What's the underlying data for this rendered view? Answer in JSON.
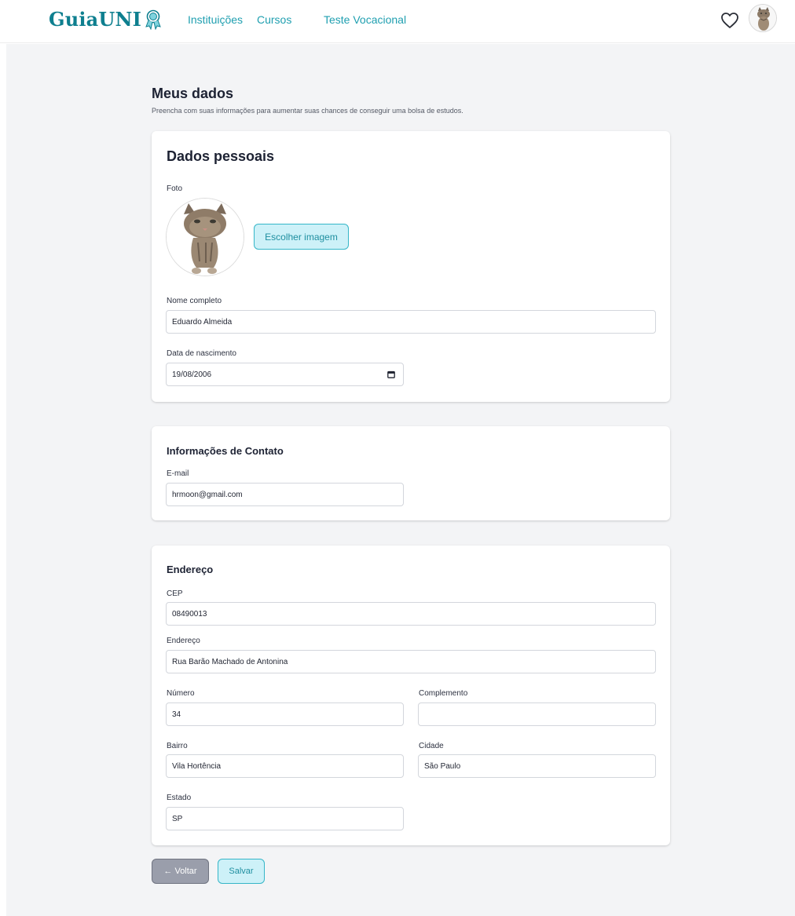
{
  "header": {
    "logo_text": "GuiaUNI",
    "logo_icon": "award-ribbon-icon",
    "nav": [
      {
        "label": "Instituições"
      },
      {
        "label": "Cursos"
      },
      {
        "label": "Teste Vocacional"
      }
    ],
    "favorites_icon": "heart-icon",
    "avatar_icon": "cat-avatar-image"
  },
  "page": {
    "title": "Meus dados",
    "subtitle": "Preencha com suas informações para aumentar suas chances de conseguir uma bolsa de estudos."
  },
  "personal": {
    "title": "Dados pessoais",
    "photo_label": "Foto",
    "choose_image_label": "Escolher imagem",
    "full_name_label": "Nome completo",
    "full_name_value": "Eduardo Almeida",
    "birth_label": "Data de nascimento",
    "birth_value": "19/08/2006",
    "calendar_icon": "calendar-icon"
  },
  "contact": {
    "title": "Informações de Contato",
    "email_label": "E-mail",
    "email_value": "hrmoon@gmail.com"
  },
  "address": {
    "title": "Endereço",
    "cep_label": "CEP",
    "cep_value": "08490013",
    "street_label": "Endereço",
    "street_value": "Rua Barão Machado de Antonina",
    "number_label": "Número",
    "number_value": "34",
    "complement_label": "Complemento",
    "complement_value": "",
    "district_label": "Bairro",
    "district_value": "Vila Hortência",
    "city_label": "Cidade",
    "city_value": "São Paulo",
    "state_label": "Estado",
    "state_value": "SP"
  },
  "actions": {
    "back_label": "← Voltar",
    "save_label": "Salvar"
  },
  "colors": {
    "accent": "#1f9fb0",
    "logo": "#0e7f8f",
    "button_light": "#cdf1f8",
    "button_back": "#9a9eab",
    "page_bg": "#f3f4f6"
  }
}
